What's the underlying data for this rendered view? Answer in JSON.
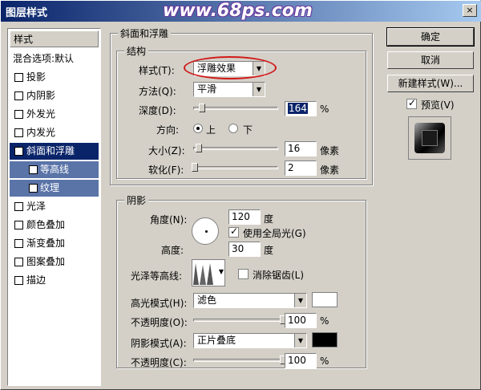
{
  "window": {
    "title": "图层样式",
    "watermark": "www.68ps.com",
    "close_label": "×"
  },
  "left_panel": {
    "header": "样式",
    "blend_options": "混合选项:默认",
    "items": [
      {
        "label": "投影",
        "checked": false
      },
      {
        "label": "内阴影",
        "checked": false
      },
      {
        "label": "外发光",
        "checked": false
      },
      {
        "label": "内发光",
        "checked": false
      },
      {
        "label": "斜面和浮雕",
        "checked": true,
        "selected": true
      },
      {
        "label": "等高线",
        "checked": false,
        "sub": true
      },
      {
        "label": "纹理",
        "checked": false,
        "sub": true
      },
      {
        "label": "光泽",
        "checked": false
      },
      {
        "label": "颜色叠加",
        "checked": false
      },
      {
        "label": "渐变叠加",
        "checked": false
      },
      {
        "label": "图案叠加",
        "checked": false
      },
      {
        "label": "描边",
        "checked": false
      }
    ]
  },
  "bevel": {
    "group_title": "斜面和浮雕",
    "structure_title": "结构",
    "style_label": "样式(T):",
    "style_value": "浮雕效果",
    "technique_label": "方法(Q):",
    "technique_value": "平滑",
    "depth_label": "深度(D):",
    "depth_value": "164",
    "depth_unit": "%",
    "depth_level": 0.1,
    "direction_label": "方向:",
    "direction_up": "上",
    "direction_down": "下",
    "size_label": "大小(Z):",
    "size_value": "16",
    "size_unit": "像素",
    "size_level": 0.07,
    "soften_label": "软化(F):",
    "soften_value": "2",
    "soften_unit": "像素",
    "soften_level": 0.02
  },
  "shading": {
    "title": "阴影",
    "angle_label": "角度(N):",
    "angle_value": "120",
    "angle_unit": "度",
    "global_light_label": "使用全局光(G)",
    "altitude_label": "高度:",
    "altitude_value": "30",
    "altitude_unit": "度",
    "gloss_label": "光泽等高线:",
    "anti_alias_label": "消除锯齿(L)",
    "highlight_mode_label": "高光模式(H):",
    "highlight_mode_value": "滤色",
    "highlight_color": "#ffffff",
    "highlight_opacity_label": "不透明度(O):",
    "highlight_opacity_value": "100",
    "highlight_opacity_unit": "%",
    "shadow_mode_label": "阴影模式(A):",
    "shadow_mode_value": "正片叠底",
    "shadow_color": "#000000",
    "shadow_opacity_label": "不透明度(C):",
    "shadow_opacity_value": "100",
    "shadow_opacity_unit": "%"
  },
  "right_panel": {
    "ok_label": "确定",
    "cancel_label": "取消",
    "new_style_label": "新建样式(W)...",
    "preview_label": "预览(V)"
  },
  "colors": {
    "title_start": "#0a246a",
    "title_end": "#a6caf0",
    "selection": "#0a246a",
    "highlight_oval": "#d01a1a"
  }
}
